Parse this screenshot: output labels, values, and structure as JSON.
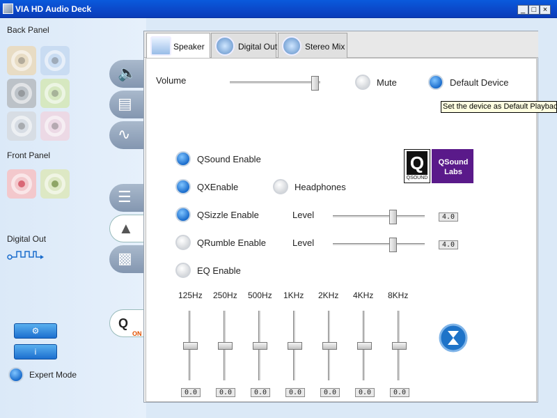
{
  "window": {
    "title": "VIA HD Audio Deck",
    "controls": [
      "_",
      "□",
      "×"
    ]
  },
  "sidebar": {
    "back_panel_label": "Back Panel",
    "front_panel_label": "Front Panel",
    "digital_out_label": "Digital Out",
    "back_jacks": [
      {
        "color": "#e8dcc4",
        "name": "back-jack-beige"
      },
      {
        "color": "#c9dcf2",
        "name": "back-jack-blue"
      },
      {
        "color": "#bcc2c8",
        "name": "back-jack-gray"
      },
      {
        "color": "#d6e8c0",
        "name": "back-jack-green"
      },
      {
        "color": "#d7dde4",
        "name": "back-jack-silver"
      },
      {
        "color": "#ecd9e5",
        "name": "back-jack-pink"
      }
    ],
    "front_jacks": [
      {
        "color": "#f3c8cc",
        "name": "front-jack-pink"
      },
      {
        "color": "#dde8c4",
        "name": "front-jack-green"
      }
    ],
    "side_tabs": [
      "speaker-volume-icon",
      "speaker-config-icon",
      "waveform-icon",
      "equalizer-icon",
      "environment-icon",
      "room-calibration-icon",
      "qsound-icon"
    ],
    "qsound_on_text": "ON",
    "expert_mode_label": "Expert Mode",
    "expert_mode_on": true
  },
  "tabs": [
    {
      "label": "Speaker",
      "icon": "speaker-icon",
      "active": true
    },
    {
      "label": "Digital Out",
      "icon": "music-note-icon",
      "active": false
    },
    {
      "label": "Stereo Mix",
      "icon": "music-note-icon",
      "active": false
    }
  ],
  "speaker": {
    "volume_label": "Volume",
    "volume_level": 0.98,
    "mute_label": "Mute",
    "mute_on": false,
    "default_device_label": "Default Device",
    "default_device_on": true,
    "tooltip": "Set the device as Default Playback",
    "qsound_logo_text": "QSound Labs",
    "qsound_badge_text": "QSOUND",
    "qsound_enable_label": "QSound Enable",
    "qsound_enable_on": true,
    "qx_enable_label": "QXEnable",
    "qx_enable_on": true,
    "headphones_label": "Headphones",
    "headphones_on": false,
    "qsizzle_label": "QSizzle Enable",
    "qsizzle_on": true,
    "qsizzle_level_label": "Level",
    "qsizzle_level": 4.0,
    "qsizzle_level_text": "4.0",
    "qsizzle_level_fraction": 0.67,
    "qrumble_label": "QRumble Enable",
    "qrumble_on": false,
    "qrumble_level_label": "Level",
    "qrumble_level": 4.0,
    "qrumble_level_text": "4.0",
    "qrumble_level_fraction": 0.67,
    "eq_enable_label": "EQ Enable",
    "eq_enable_on": false,
    "eq_bands": [
      {
        "freq": "125Hz",
        "value": "0.0"
      },
      {
        "freq": "250Hz",
        "value": "0.0"
      },
      {
        "freq": "500Hz",
        "value": "0.0"
      },
      {
        "freq": "1KHz",
        "value": "0.0"
      },
      {
        "freq": "2KHz",
        "value": "0.0"
      },
      {
        "freq": "4KHz",
        "value": "0.0"
      },
      {
        "freq": "8KHz",
        "value": "0.0"
      }
    ],
    "eq_reset_icon": "hourglass-reset-icon"
  }
}
